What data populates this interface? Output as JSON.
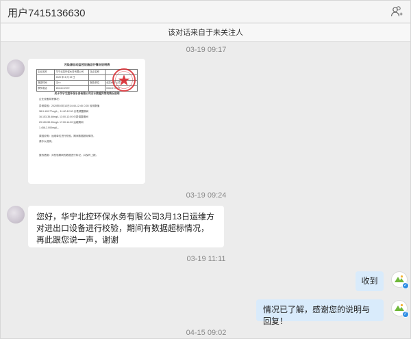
{
  "header": {
    "title": "用户7415136630"
  },
  "notice": {
    "text": "该对话来自于未关注人"
  },
  "timestamps": [
    "03-19 09:17",
    "03-19 09:24",
    "03-19 11:11",
    "04-15 09:02"
  ],
  "document": {
    "title": "污染源自动监控设施运行情况说明表",
    "rows": [
      [
        "企业名称",
        "华宁北控环保水务有限公司",
        "站点名称",
        ""
      ],
      [
        "",
        "2020 年 3 月 19 日",
        "",
        ""
      ],
      [
        "报告时间",
        "王××",
        "报告单位",
        "北控水务 公章"
      ],
      [
        "联系电话",
        "15xxxx72470",
        "",
        "15xxxx72470"
      ]
    ],
    "subtitle": "关于华宁北控环保水务有限公司污水数据异常的情况说明",
    "lines": [
      "企业设备异常情况：",
      "异常原因：2020年03月13日14:45-12:45 COD 检测数值",
      "38.9-100.77mg/L，11:00-12:00 仪表调整期间",
      "16.153-35.68mg/L 13:00-12:00 仪表调整期间",
      "29.150-59.00mg/L 17:00-14:00 运维期间",
      "1.458-2.000mg/L。",
      "原因说明：运维单位进行校验，期间数据超标情况，",
      "请予以说明。",
      "",
      "整改措施：对校验期间的数据进行标记，并及时上报。"
    ]
  },
  "messages": [
    {
      "side": "left",
      "text": "您好，华宁北控环保水务有限公司3月13日运维方对进出口设备进行校验，期间有数据超标情况，再此跟您说一声，谢谢"
    },
    {
      "side": "right",
      "text": "收到"
    },
    {
      "side": "right",
      "text": "情况已了解，感谢您的说明与回复！"
    }
  ],
  "colors": {
    "right_bubble": "#d9ebfb",
    "badge": "#2f8de4"
  },
  "icons": {
    "header_action": "add-friend-icon",
    "verified": "verified-badge-icon"
  }
}
